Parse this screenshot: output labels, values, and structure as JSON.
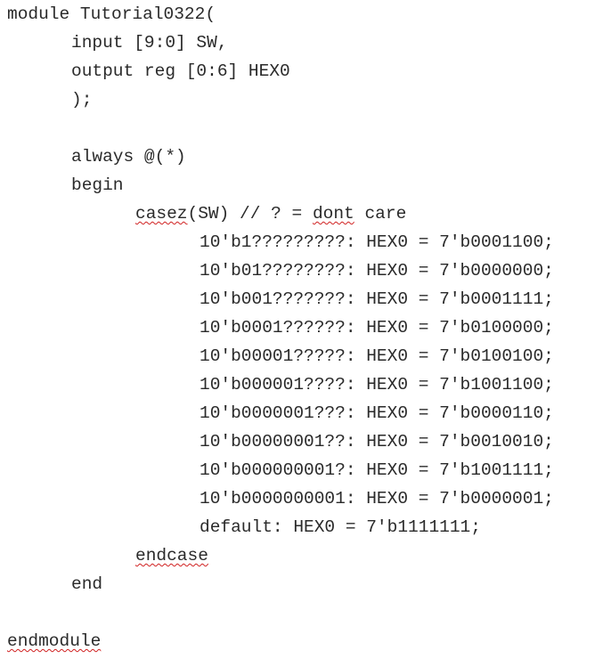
{
  "document": {
    "lines": [
      {
        "indent": 0,
        "segments": [
          {
            "text": "module Tutorial0322("
          }
        ]
      },
      {
        "indent": 1,
        "segments": [
          {
            "text": "input [9:0] SW,"
          }
        ]
      },
      {
        "indent": 1,
        "segments": [
          {
            "text": "output reg [0:6] HEX0"
          }
        ]
      },
      {
        "indent": 1,
        "segments": [
          {
            "text": ");"
          }
        ]
      },
      {
        "indent": 0,
        "segments": [
          {
            "text": ""
          }
        ]
      },
      {
        "indent": 1,
        "segments": [
          {
            "text": "always @(*)"
          }
        ]
      },
      {
        "indent": 1,
        "segments": [
          {
            "text": "begin"
          }
        ]
      },
      {
        "indent": 2,
        "segments": [
          {
            "text": "casez",
            "squiggle": true
          },
          {
            "text": "(SW) // ? = "
          },
          {
            "text": "dont",
            "squiggle": true
          },
          {
            "text": " care"
          }
        ]
      },
      {
        "indent": 3,
        "segments": [
          {
            "text": "10'b1?????????: HEX0 = 7'b0001100;"
          }
        ]
      },
      {
        "indent": 3,
        "segments": [
          {
            "text": "10'b01????????: HEX0 = 7'b0000000;"
          }
        ]
      },
      {
        "indent": 3,
        "segments": [
          {
            "text": "10'b001???????: HEX0 = 7'b0001111;"
          }
        ]
      },
      {
        "indent": 3,
        "segments": [
          {
            "text": "10'b0001??????: HEX0 = 7'b0100000;"
          }
        ]
      },
      {
        "indent": 3,
        "segments": [
          {
            "text": "10'b00001?????: HEX0 = 7'b0100100;"
          }
        ]
      },
      {
        "indent": 3,
        "segments": [
          {
            "text": "10'b000001????: HEX0 = 7'b1001100;"
          }
        ]
      },
      {
        "indent": 3,
        "segments": [
          {
            "text": "10'b0000001???: HEX0 = 7'b0000110;"
          }
        ]
      },
      {
        "indent": 3,
        "segments": [
          {
            "text": "10'b00000001??: HEX0 = 7'b0010010;"
          }
        ]
      },
      {
        "indent": 3,
        "segments": [
          {
            "text": "10'b000000001?: HEX0 = 7'b1001111;"
          }
        ]
      },
      {
        "indent": 3,
        "segments": [
          {
            "text": "10'b0000000001: HEX0 = 7'b0000001;"
          }
        ]
      },
      {
        "indent": 3,
        "segments": [
          {
            "text": "default: HEX0 = 7'b1111111;"
          }
        ]
      },
      {
        "indent": 2,
        "segments": [
          {
            "text": "endcase",
            "squiggle": true
          }
        ]
      },
      {
        "indent": 1,
        "segments": [
          {
            "text": "end"
          }
        ]
      },
      {
        "indent": 0,
        "segments": [
          {
            "text": ""
          }
        ]
      },
      {
        "indent": 0,
        "segments": [
          {
            "text": "endmodule",
            "squiggle": true
          }
        ]
      }
    ]
  },
  "colors": {
    "text": "#2a2a2a",
    "spellcheck_underline": "#d02020",
    "background": "#ffffff"
  }
}
